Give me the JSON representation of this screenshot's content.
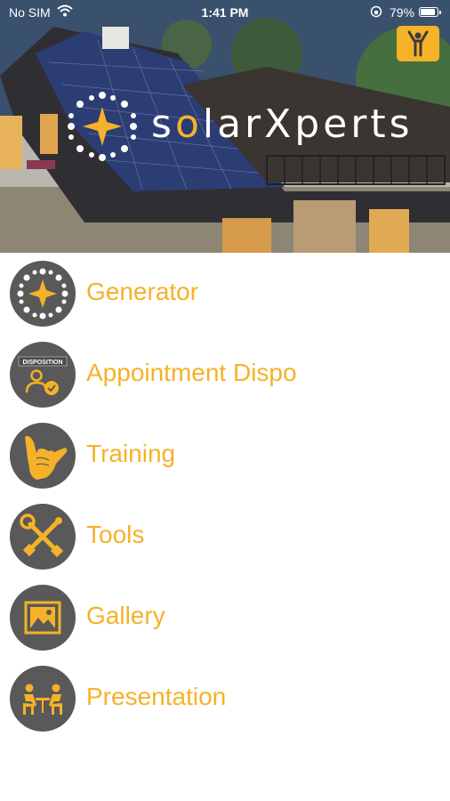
{
  "status_bar": {
    "carrier": "No SIM",
    "time": "1:41 PM",
    "battery": "79%",
    "battery_level": 0.79
  },
  "hero": {
    "brand_prefix": "s",
    "brand_o": "o",
    "brand_rest": "larXperts"
  },
  "menu": {
    "items": [
      {
        "label": "Generator",
        "icon": "generator-icon"
      },
      {
        "label": "Appointment Dispo",
        "icon": "disposition-icon",
        "icon_text": "DISPOSITION"
      },
      {
        "label": "Training",
        "icon": "shaka-hand-icon"
      },
      {
        "label": "Tools",
        "icon": "tools-icon"
      },
      {
        "label": "Gallery",
        "icon": "gallery-icon"
      },
      {
        "label": "Presentation",
        "icon": "presentation-icon"
      }
    ]
  },
  "colors": {
    "accent": "#f5b228",
    "icon_circle": "#595959"
  }
}
